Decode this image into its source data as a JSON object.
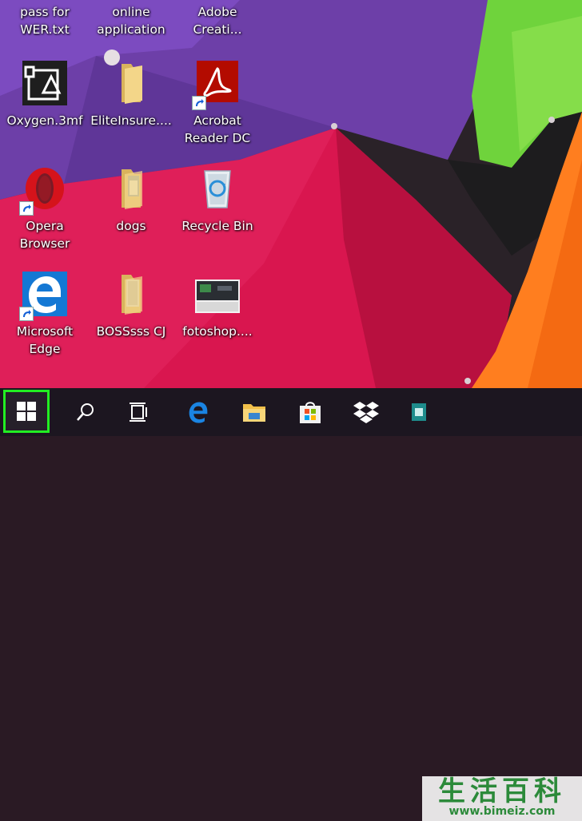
{
  "desktop": {
    "icons": [
      {
        "label": "pass for\nWER.txt"
      },
      {
        "label": "online\napplication"
      },
      {
        "label": "Adobe\nCreati..."
      },
      {
        "label": "Oxygen.3mf"
      },
      {
        "label": "EliteInsure...."
      },
      {
        "label": "Acrobat\nReader DC"
      },
      {
        "label": "Opera\nBrowser"
      },
      {
        "label": "dogs"
      },
      {
        "label": "Recycle Bin"
      },
      {
        "label": "Microsoft\nEdge"
      },
      {
        "label": "BOSSsss CJ"
      },
      {
        "label": "fotoshop...."
      }
    ]
  },
  "taskbar": {
    "items": [
      "windows-start",
      "search",
      "task-view",
      "edge",
      "file-explorer",
      "store",
      "dropbox",
      "app"
    ],
    "highlight_color": "#22ee22"
  },
  "watermark": {
    "title": "生活百科",
    "url": "www.bimeiz.com"
  }
}
